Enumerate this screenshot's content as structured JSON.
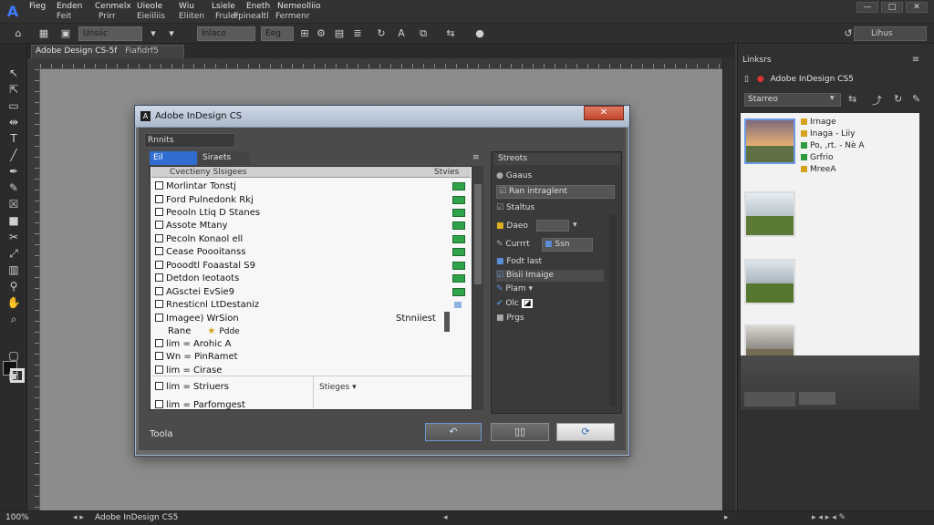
{
  "menubar": {
    "logo": "A",
    "items_top": [
      "Fieg",
      "Enden",
      "Cenmelx",
      "Uieole",
      "Wiu",
      "Lsiele",
      "Eneth",
      "Nemeolliio"
    ],
    "items_bottom": [
      "Feit",
      "Prirr",
      "Eieiiliis",
      "Eliiten",
      "Fruler",
      "Fpinealtl",
      "Fermenr"
    ],
    "window_controls": [
      "—",
      "□",
      "✕"
    ]
  },
  "controlbar": {
    "fields": [
      "Unsiic",
      "Inlaco",
      "Eeg"
    ],
    "search": "Lihus"
  },
  "document": {
    "tab_label": "Adobe Design CS-5f",
    "tab_suffix": "Fiafidrf5"
  },
  "status": {
    "left": "100%",
    "doc": "Adobe InDesign CS5"
  },
  "links_panel": {
    "title": "Linksrs",
    "doc_name": "Adobe InDesign CS5",
    "filter": "Starreo",
    "entries": [
      {
        "label": "Irnage",
        "color": "#d6a21c"
      },
      {
        "label": "Inaga - Liiy",
        "color": "#d6a21c"
      },
      {
        "label": "Po, ,rt. - Nè A",
        "color": "#2f9b3e"
      },
      {
        "label": "Grfrio",
        "color": "#2f9b3e"
      },
      {
        "label": "MreeA",
        "color": "#d6a21c"
      }
    ]
  },
  "dialog": {
    "title": "Adobe InDesign CS",
    "close": "✕",
    "name_field": "Rnnits",
    "tabs": [
      "Eil",
      "Siraets"
    ],
    "list_header_left": "Cvectieny Slsigees",
    "list_header_right": "Stvies",
    "rows": [
      "Morlintar Tonstj",
      "Ford Pulnedonk Rkj",
      "Peooln Ltiq D Stanes",
      "Assote Mtany",
      "Pecoln Konaol ell",
      "Cease Poooitanss",
      "Pooodtl Foaastal S9",
      "Detdon Ieotaots",
      "AGsctei EvSie9",
      "Rnesticnl LtDestaniz",
      "Imagee) WrSion",
      "Rane",
      "lim = Arohic A",
      "Wn = PinRamet",
      "lim = Cirase",
      "lim = Striuers",
      "lim = Parfomgest"
    ],
    "row_note_right": "Stnniiest",
    "row_sub_note": "Pdde",
    "bottom_strip_right": "Stieges",
    "props_title": "Streots",
    "props": [
      "Gaaus",
      "Ran intraglent",
      "Staltus",
      "Daeo",
      "Currrt",
      "Ssn",
      "Fodt last",
      "Bisii Imaige",
      "Plam",
      "Olc",
      "Prgs"
    ],
    "footer_label": "Toola",
    "buttons": [
      "↶",
      "▯▯",
      "⟳"
    ]
  }
}
